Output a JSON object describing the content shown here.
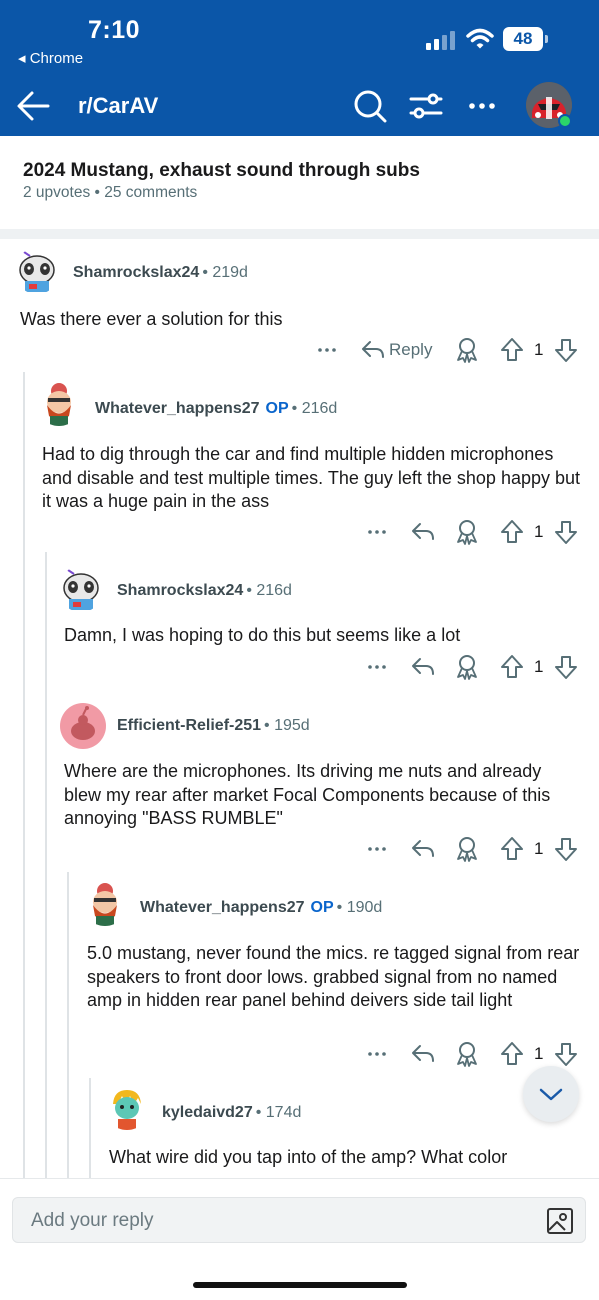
{
  "status_bar": {
    "time": "7:10",
    "back_app": "◂ Chrome",
    "battery": "48"
  },
  "header": {
    "title": "r/CarAV"
  },
  "post": {
    "title": "2024 Mustang, exhaust sound through subs",
    "meta": "2 upvotes • 25 comments"
  },
  "comments": [
    {
      "author": "Shamrockslax24",
      "op": "",
      "age": "• 219d",
      "body": "Was there ever a solution for this",
      "reply_label": "Reply",
      "votes": "1",
      "avatar": "panda-avatar"
    },
    {
      "author": "Whatever_happens27",
      "op": "OP",
      "age": "• 216d",
      "body": "Had to dig through the car and find multiple hidden microphones and disable and test multiple times. The guy left the shop happy but it was a huge pain in the ass",
      "votes": "1",
      "avatar": "bearded-avatar"
    },
    {
      "author": "Shamrockslax24",
      "op": "",
      "age": "• 216d",
      "body": "Damn, I was hoping to do this but seems like a lot",
      "votes": "1",
      "avatar": "panda-avatar"
    },
    {
      "author": "Efficient-Relief-251",
      "op": "",
      "age": "• 195d",
      "body": "Where are the microphones. Its driving me nuts and already blew my rear after market Focal Components because of this annoying \"BASS RUMBLE\"",
      "votes": "1",
      "avatar": "default-snoo-avatar"
    },
    {
      "author": "Whatever_happens27",
      "op": "OP",
      "age": "• 190d",
      "body": "5.0 mustang, never found the mics. re tagged signal from rear speakers to front door lows. grabbed signal from no named amp in hidden rear panel behind deivers side tail light",
      "votes": "1",
      "avatar": "bearded-avatar"
    },
    {
      "author": "kyledaivd27",
      "op": "",
      "age": "• 174d",
      "body": "What wire did you tap into of the amp? What color",
      "avatar": "zombie-avatar"
    }
  ],
  "reply_bar": {
    "placeholder": "Add your reply"
  },
  "icons": {
    "back": "back-arrow-icon",
    "search": "search-icon",
    "filter": "filter-icon",
    "more": "more-icon",
    "reply": "reply-icon",
    "award": "award-icon",
    "upvote": "upvote-icon",
    "downvote": "downvote-icon",
    "image": "image-icon",
    "jump": "chevron-down-icon"
  },
  "colors": {
    "header_bg": "#0b56a8",
    "op_blue": "#0a65cc",
    "online": "#2bd46a"
  }
}
